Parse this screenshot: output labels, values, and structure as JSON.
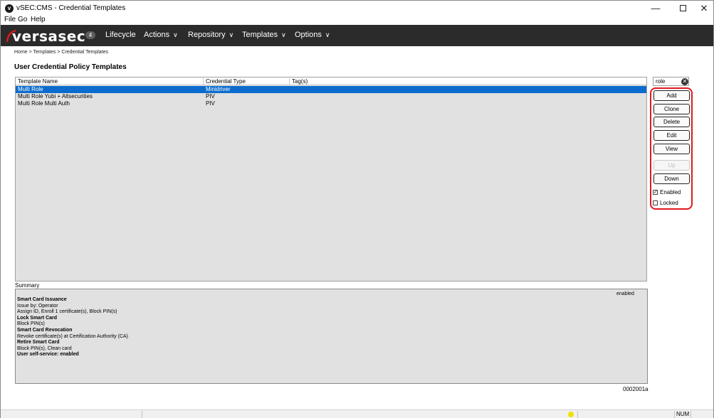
{
  "window": {
    "title": "vSEC:CMS - Credential Templates",
    "minimize": "—",
    "close": "✕"
  },
  "menu": [
    "File",
    "Go",
    "Help"
  ],
  "nav": {
    "logo": "versasec",
    "badge": "4",
    "items": [
      {
        "label": "Lifecycle",
        "chevron": ""
      },
      {
        "label": "Actions",
        "chevron": "∨"
      },
      {
        "label": "Repository",
        "chevron": "∨"
      },
      {
        "label": "Templates",
        "chevron": "∨"
      },
      {
        "label": "Options",
        "chevron": "∨"
      }
    ]
  },
  "breadcrumb": "Home > Templates > Credential Templates",
  "page_title": "User Credential Policy Templates",
  "table": {
    "columns": [
      "Template Name",
      "Credential Type",
      "Tag(s)"
    ],
    "rows": [
      {
        "name": "Multi Role",
        "type": "Minidriver",
        "selected": true
      },
      {
        "name": "Multi Role Yubi + Altsecurities",
        "type": "PIV",
        "selected": false
      },
      {
        "name": "Multi Role Multi Auth",
        "type": "PIV",
        "selected": false
      }
    ]
  },
  "search": {
    "value": "role",
    "clear_icon": "✕"
  },
  "buttons": {
    "add": "Add",
    "clone": "Clone",
    "delete": "Delete",
    "edit": "Edit",
    "view": "View",
    "up": "Up",
    "down": "Down"
  },
  "checkboxes": {
    "enabled": {
      "label": "Enabled",
      "checked": true,
      "mark": "✓"
    },
    "locked": {
      "label": "Locked",
      "checked": false
    }
  },
  "summary": {
    "label": "Summary",
    "status": "enabled",
    "lines": [
      {
        "text": "Smart Card Issuance",
        "bold": true
      },
      {
        "text": "Issue by: Operator",
        "bold": false
      },
      {
        "text": "Assign ID, Enroll 1 certificate(s), Block PIN(s)",
        "bold": false
      },
      {
        "text": "Lock Smart Card",
        "bold": true
      },
      {
        "text": "Block PIN(s)",
        "bold": false
      },
      {
        "text": "Smart Card Revocation",
        "bold": true
      },
      {
        "text": "Revoke certificate(s) at Certification Authority (CA)",
        "bold": false
      },
      {
        "text": "Retire Smart Card",
        "bold": true
      },
      {
        "text": "Block PIN(s), Clean card",
        "bold": false
      },
      {
        "text": "User self-service: enabled",
        "bold": true
      }
    ],
    "code": "0002001a"
  },
  "statusbar": {
    "num": "NUM"
  },
  "colors": {
    "nav_bg": "#2b2b2b",
    "selection": "#0c6ccd",
    "highlight": "#e0191f",
    "status_dot": "#f0e000"
  }
}
